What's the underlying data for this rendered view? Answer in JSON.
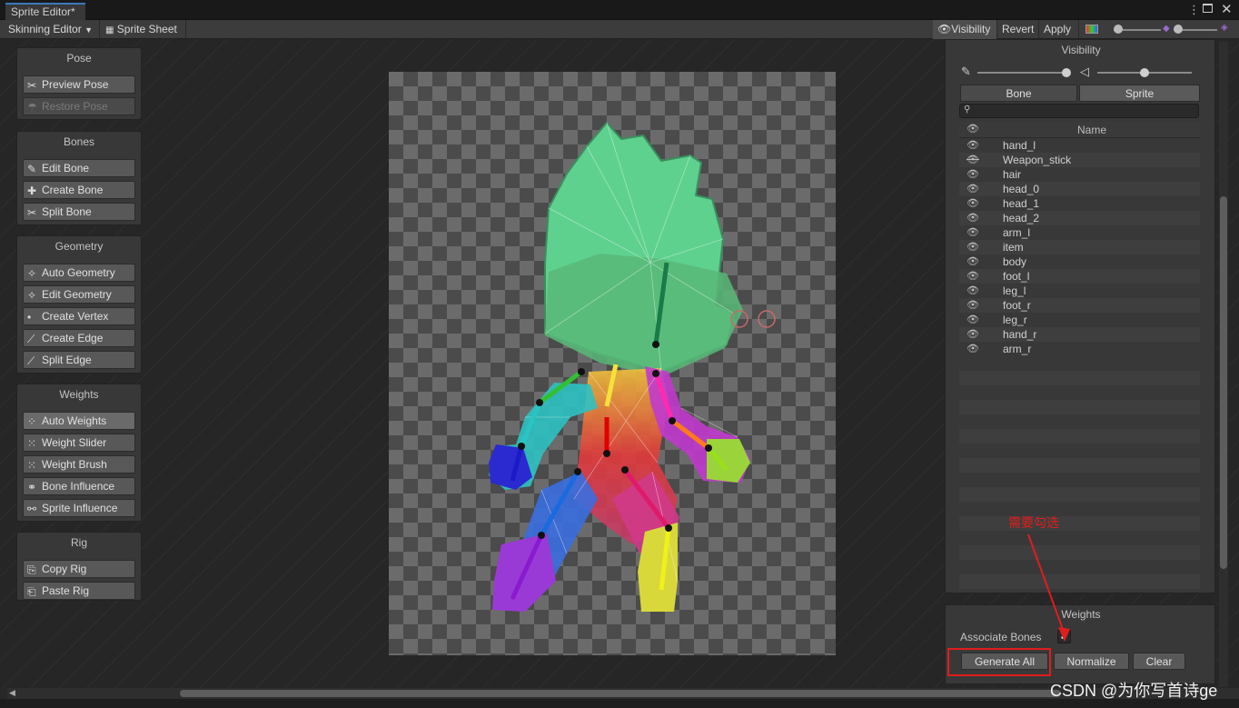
{
  "window": {
    "tab_title": "Sprite Editor*",
    "menu_icon": "kebab-menu-icon",
    "maximize_icon": "maximize-icon",
    "close_icon": "close-icon"
  },
  "toolbar": {
    "mode_dropdown": "Skinning Editor",
    "sprite_sheet": "Sprite Sheet",
    "visibility": "Visibility",
    "revert": "Revert",
    "apply": "Apply"
  },
  "left_panels": {
    "pose": {
      "title": "Pose",
      "items": [
        {
          "label": "Preview Pose",
          "icon": "bones-icon"
        },
        {
          "label": "Restore Pose",
          "icon": "restore-pose-icon"
        }
      ]
    },
    "bones": {
      "title": "Bones",
      "items": [
        {
          "label": "Edit Bone",
          "icon": "edit-bone-icon"
        },
        {
          "label": "Create Bone",
          "icon": "create-bone-icon"
        },
        {
          "label": "Split Bone",
          "icon": "split-bone-icon"
        }
      ]
    },
    "geometry": {
      "title": "Geometry",
      "items": [
        {
          "label": "Auto Geometry",
          "icon": "auto-geometry-icon"
        },
        {
          "label": "Edit Geometry",
          "icon": "edit-geometry-icon"
        },
        {
          "label": "Create Vertex",
          "icon": "create-vertex-icon"
        },
        {
          "label": "Create Edge",
          "icon": "create-edge-icon"
        },
        {
          "label": "Split Edge",
          "icon": "split-edge-icon"
        }
      ]
    },
    "weights": {
      "title": "Weights",
      "items": [
        {
          "label": "Auto Weights",
          "icon": "auto-weights-icon"
        },
        {
          "label": "Weight Slider",
          "icon": "weight-slider-icon"
        },
        {
          "label": "Weight Brush",
          "icon": "weight-brush-icon"
        },
        {
          "label": "Bone Influence",
          "icon": "bone-influence-icon"
        },
        {
          "label": "Sprite Influence",
          "icon": "sprite-influence-icon"
        }
      ]
    },
    "rig": {
      "title": "Rig",
      "items": [
        {
          "label": "Copy Rig",
          "icon": "copy-icon"
        },
        {
          "label": "Paste Rig",
          "icon": "paste-icon"
        }
      ]
    }
  },
  "visibility_panel": {
    "title": "Visibility",
    "tabs": [
      "Bone",
      "Sprite"
    ],
    "search_placeholder": "",
    "column_name": "Name",
    "rows": [
      "hand_l",
      "Weapon_stick",
      "hair",
      "head_0",
      "head_1",
      "head_2",
      "arm_l",
      "item",
      "body",
      "foot_l",
      "leg_l",
      "foot_r",
      "leg_r",
      "hand_r",
      "arm_r"
    ],
    "hidden_row": "Weapon_stick"
  },
  "weights_panel": {
    "title": "Weights",
    "associate_bones_label": "Associate Bones",
    "associate_bones_checked": true,
    "generate_all": "Generate All",
    "normalize": "Normalize",
    "clear": "Clear"
  },
  "annotation": {
    "text": "需要勾选",
    "color": "#e11d1d"
  },
  "watermark": "CSDN @为你写首诗ge",
  "colors": {
    "accent_tab": "#3a79bb",
    "highlight_box": "#e11d1d",
    "panel_bg": "#383838",
    "canvas_bg": "#262626"
  }
}
